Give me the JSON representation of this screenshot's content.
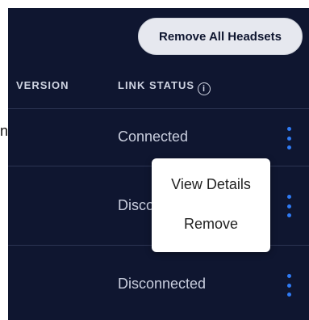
{
  "toolbar": {
    "remove_all_label": "Remove All Headsets"
  },
  "table": {
    "columns": {
      "version": "VERSION",
      "link_status": "LINK STATUS"
    },
    "info_glyph": "i",
    "rows": [
      {
        "status": "Connected"
      },
      {
        "status": "Disco"
      },
      {
        "status": "Disconnected"
      }
    ]
  },
  "context_menu": {
    "items": [
      {
        "label": "View Details"
      },
      {
        "label": "Remove"
      }
    ]
  },
  "stray_mark": "n",
  "colors": {
    "accent": "#2f7bf5",
    "background": "#0f1630",
    "menu_bg": "#ffffff"
  },
  "icons": [
    "info-icon",
    "kebab-menu-icon"
  ]
}
